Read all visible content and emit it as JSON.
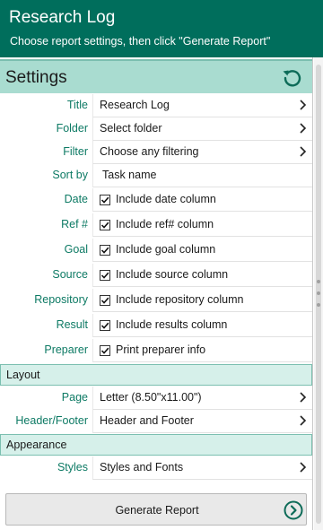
{
  "header": {
    "title": "Research Log",
    "subtitle": "Choose report settings, then click \"Generate Report\""
  },
  "settings": {
    "label": "Settings"
  },
  "rows": {
    "title": {
      "label": "Title",
      "value": "Research Log"
    },
    "folder": {
      "label": "Folder",
      "value": "Select folder"
    },
    "filter": {
      "label": "Filter",
      "value": "Choose any filtering"
    },
    "sortby": {
      "label": "Sort by",
      "value": "Task name"
    },
    "date": {
      "label": "Date",
      "value": "Include date column",
      "checked": true
    },
    "ref": {
      "label": "Ref #",
      "value": "Include ref# column",
      "checked": true
    },
    "goal": {
      "label": "Goal",
      "value": "Include goal column",
      "checked": true
    },
    "source": {
      "label": "Source",
      "value": "Include source column",
      "checked": true
    },
    "repository": {
      "label": "Repository",
      "value": "Include repository column",
      "checked": true
    },
    "result": {
      "label": "Result",
      "value": "Include results column",
      "checked": true
    },
    "preparer": {
      "label": "Preparer",
      "value": "Print preparer info",
      "checked": true
    },
    "page": {
      "label": "Page",
      "value": "Letter (8.50\"x11.00\")"
    },
    "headerfooter": {
      "label": "Header/Footer",
      "value": "Header and Footer"
    },
    "styles": {
      "label": "Styles",
      "value": "Styles and Fonts"
    }
  },
  "sections": {
    "layout": "Layout",
    "appearance": "Appearance"
  },
  "generate_button": {
    "label": "Generate Report"
  },
  "icons": {
    "reset": "refresh-icon",
    "chevron": "chevron-right-icon",
    "checkbox": "check-icon",
    "go": "arrow-circle-right-icon"
  },
  "colors": {
    "header_bg": "#006e5c",
    "settings_bar_bg": "#a9dcd0",
    "section_bar_bg": "#d6f0ea",
    "label_text": "#0d7a64",
    "accent": "#0d6b58"
  }
}
